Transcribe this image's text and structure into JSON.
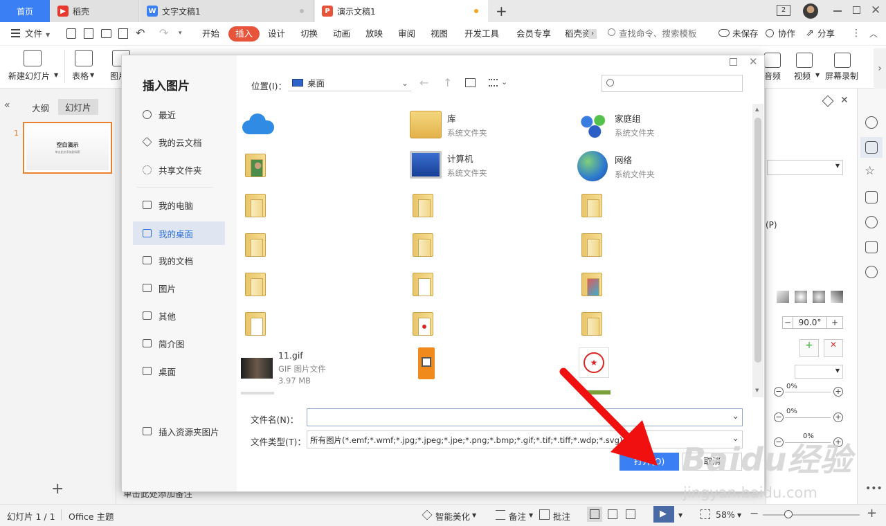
{
  "tabs": {
    "home": "首页",
    "daoke": "稻壳",
    "writer": "文字文稿1",
    "presentation": "演示文稿1",
    "add": "+",
    "badge": "2"
  },
  "menu": {
    "file": "文件",
    "items": [
      "开始",
      "插入",
      "设计",
      "切换",
      "动画",
      "放映",
      "审阅",
      "视图",
      "开发工具",
      "会员专享",
      "稻壳资"
    ],
    "search_placeholder": "查找命令、搜索模板",
    "unsaved": "未保存",
    "collab": "协作",
    "share": "分享"
  },
  "ribbon": {
    "new_slide": "新建幻灯片",
    "table": "表格",
    "picture": "图片",
    "audio": "音频",
    "video": "视频",
    "screen_record": "屏幕录制"
  },
  "left_panel": {
    "outline_tab": "大纲",
    "slides_tab": "幻灯片",
    "slide_number": "1",
    "slide_title": "空白演示",
    "slide_subtitle": "单击此处添加副标题",
    "notes_hint": "单击此处添加备注"
  },
  "dialog": {
    "title": "插入图片",
    "location_label": "位置(I)：",
    "location_value": "桌面",
    "nav": [
      "最近",
      "我的云文档",
      "共享文件夹",
      "我的电脑",
      "我的桌面",
      "我的文档",
      "图片",
      "其他",
      "简介图",
      "桌面"
    ],
    "resource_pictures": "插入资源夹图片",
    "files": [
      {
        "name": "库",
        "sub": "系统文件夹"
      },
      {
        "name": "家庭组",
        "sub": "系统文件夹"
      },
      {
        "name": "计算机",
        "sub": "系统文件夹"
      },
      {
        "name": "网络",
        "sub": "系统文件夹"
      },
      {
        "name": "11.gif",
        "sub": "GIF 图片文件",
        "size": "3.97 MB"
      }
    ],
    "filename_label": "文件名(N)：",
    "filename_value": "",
    "filetype_label": "文件类型(T)：",
    "filetype_value": "所有图片(*.emf;*.wmf;*.jpg;*.jpeg;*.jpe;*.png;*.bmp;*.gif;*.tif;*.tiff;*.wdp;*.svg)",
    "open_button": "打开(O)",
    "cancel_button": "取消"
  },
  "right_panel": {
    "angle_value": "90.0°",
    "percent_values": [
      "0%",
      "0%",
      "0%"
    ],
    "p_label": "(P)"
  },
  "status": {
    "slide_counter": "幻灯片 1 / 1",
    "theme": "Office 主题",
    "beautify": "智能美化",
    "notes": "备注",
    "comments": "批注",
    "zoom": "58%"
  },
  "watermark": {
    "brand": "Baidu经验",
    "url": "jingyan.baidu.com"
  },
  "colors": {
    "accent": "#3b7ff5",
    "insert_tab": "#e8533b",
    "thumb_border": "#e8822e",
    "arrow": "#f01010"
  }
}
